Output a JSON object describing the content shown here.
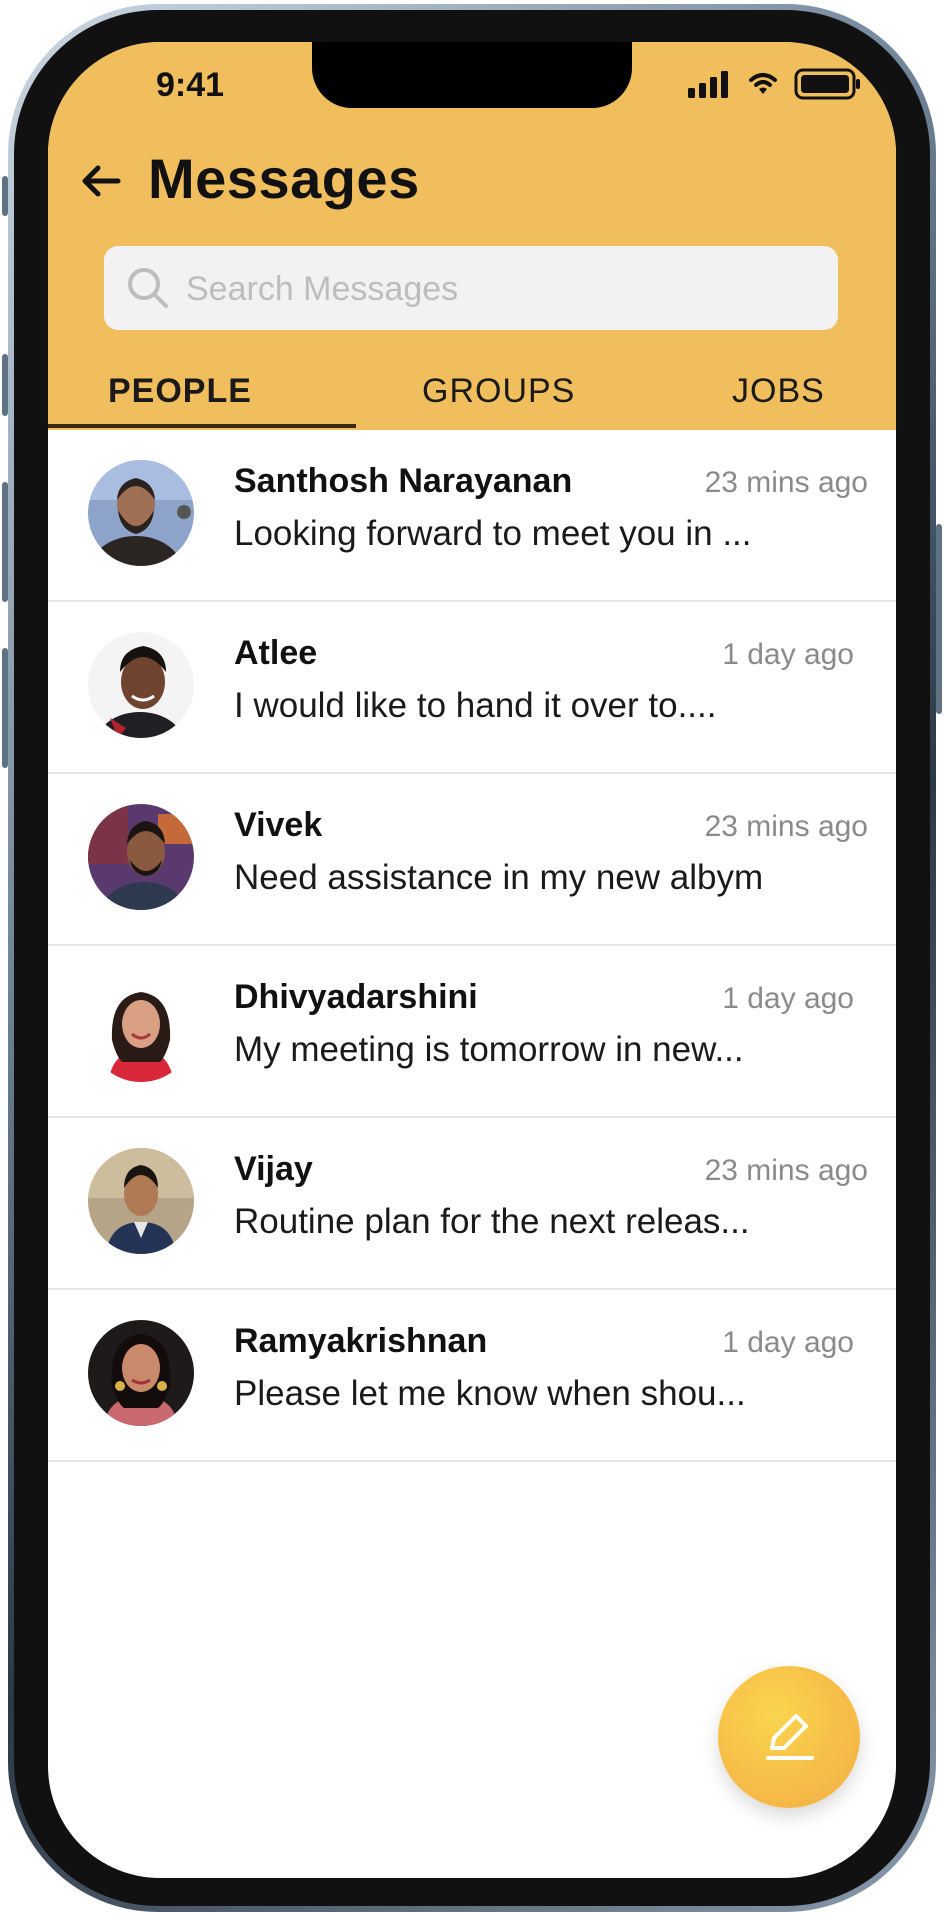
{
  "status_bar": {
    "time": "9:41"
  },
  "header": {
    "title": "Messages",
    "search_placeholder": "Search Messages"
  },
  "tabs": [
    {
      "label": "PEOPLE",
      "active": true
    },
    {
      "label": "GROUPS",
      "active": false
    },
    {
      "label": "JOBS",
      "active": false
    }
  ],
  "conversations": [
    {
      "name": "Santhosh Narayanan",
      "time": "23 mins ago",
      "preview": "Looking forward to meet you in ..."
    },
    {
      "name": "Atlee",
      "time": "1 day ago",
      "preview": "I would like to hand it over to...."
    },
    {
      "name": "Vivek",
      "time": "23 mins ago",
      "preview": "Need assistance in my new albym"
    },
    {
      "name": "Dhivyadarshini",
      "time": "1 day ago",
      "preview": "My meeting is tomorrow in new..."
    },
    {
      "name": "Vijay",
      "time": "23 mins ago",
      "preview": "Routine plan for the next releas..."
    },
    {
      "name": "Ramyakrishnan",
      "time": "1 day ago",
      "preview": "Please let me know when shou..."
    }
  ],
  "icons": {
    "back": "arrow-left-icon",
    "search": "search-icon",
    "compose": "pencil-icon",
    "signal": "signal-icon",
    "wifi": "wifi-icon",
    "battery": "battery-icon"
  },
  "colors": {
    "header": "#F1BE5E",
    "fab": "#F6BE48",
    "time_text": "#8A8A8A"
  }
}
